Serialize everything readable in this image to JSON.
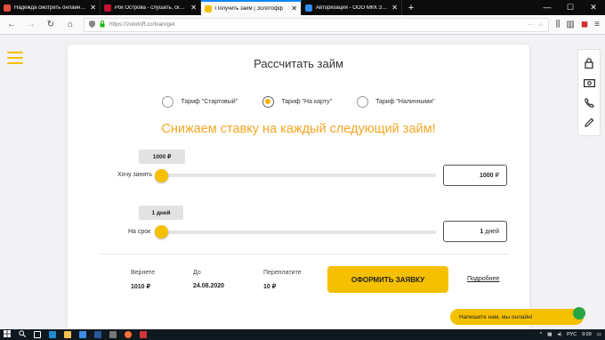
{
  "browser": {
    "tabs": [
      {
        "title": "Надежда смотреть онлайн 1 сезон",
        "favicon_color": "#e84b3a"
      },
      {
        "title": "Рок Острова - слушать, скачать",
        "favicon_color": "#c8102e"
      },
      {
        "title": "Получить займ | Золотофф",
        "favicon_color": "#f5c000"
      },
      {
        "title": "Авторизация - ООО МКК Золото",
        "favicon_color": "#2d8cf0"
      }
    ],
    "new_tab": "+",
    "window_controls": {
      "minimize": "—",
      "maximize": "☐",
      "close": "✕"
    },
    "url": "https://zolotoff.cc/loan/get"
  },
  "page": {
    "title": "Рассчитать займ",
    "tariffs": [
      {
        "label": "Тариф \"Стартовый\"",
        "selected": false
      },
      {
        "label": "Тариф \"На карту\"",
        "selected": true
      },
      {
        "label": "Тариф \"Наличными\"",
        "selected": false
      }
    ],
    "promo": "Снижаем ставку на каждый следующий займ!",
    "amount": {
      "badge": "1000 ₽",
      "label": "Хочу занять",
      "value": "1000",
      "unit": "₽",
      "slider_level": 0
    },
    "term": {
      "badge": "1 дней",
      "label": "На срок",
      "value": "1",
      "unit": "дней",
      "slider_level": 0
    },
    "summary": {
      "return_label": "Вернете",
      "return_value": "1010 ₽",
      "until_label": "До",
      "until_value": "24.08.2020",
      "overpay_label": "Переплатите",
      "overpay_value": "10 ₽"
    },
    "submit_label": "ОФОРМИТЬ ЗАЯВКУ",
    "more_label": "Подробнее",
    "chat_label": "Напишите нам, мы онлайн!"
  },
  "taskbar": {
    "lang": "РУС",
    "time": "9:09"
  },
  "colors": {
    "accent": "#f5c000",
    "promo": "#f5a623",
    "chat_online": "#26a644"
  }
}
